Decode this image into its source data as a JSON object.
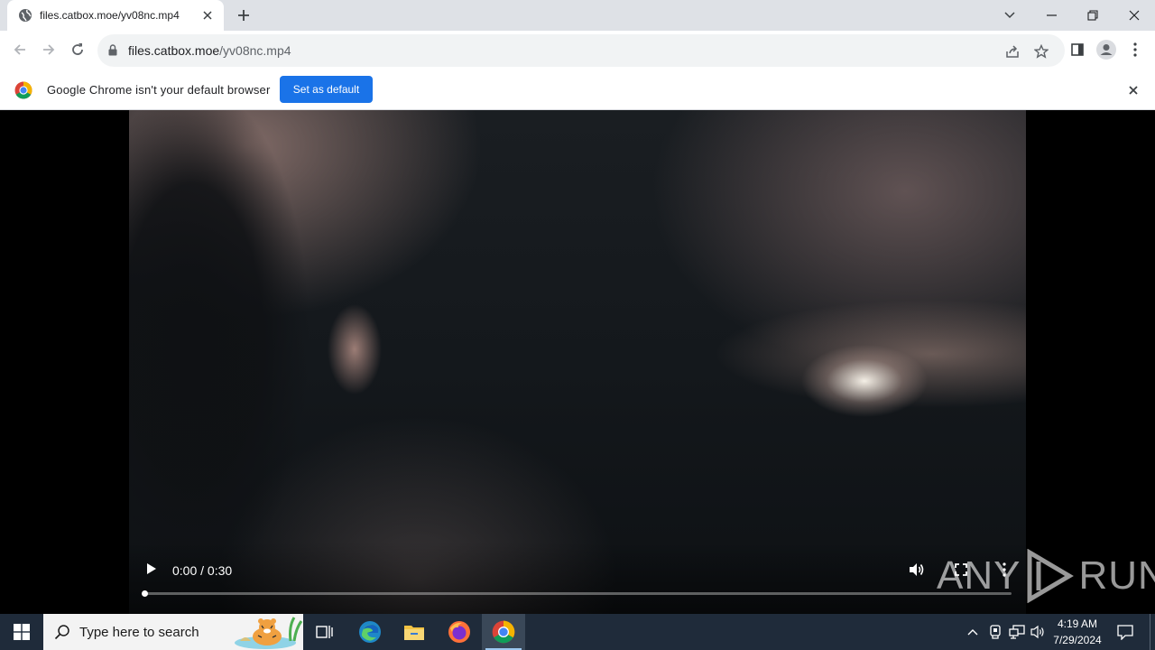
{
  "browser": {
    "tab_title": "files.catbox.moe/yv08nc.mp4",
    "url_host": "files.catbox.moe",
    "url_path": "/yv08nc.mp4"
  },
  "infobar": {
    "message": "Google Chrome isn't your default browser",
    "button_label": "Set as default"
  },
  "video": {
    "time": "0:00 / 0:30",
    "progress": 0
  },
  "watermark": {
    "left": "ANY",
    "right": "RUN"
  },
  "taskbar": {
    "search_placeholder": "Type here to search",
    "time": "4:19 AM",
    "date": "7/29/2024"
  }
}
